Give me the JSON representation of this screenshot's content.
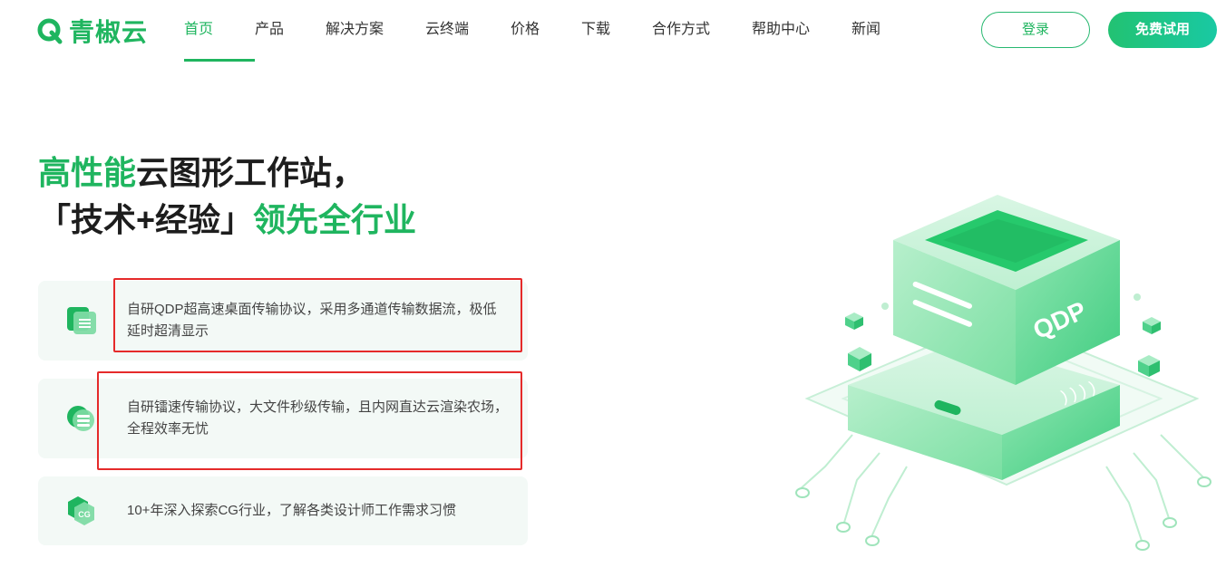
{
  "header": {
    "logo_text": "青椒云",
    "nav": [
      {
        "label": "首页",
        "active": true
      },
      {
        "label": "产品"
      },
      {
        "label": "解决方案"
      },
      {
        "label": "云终端"
      },
      {
        "label": "价格"
      },
      {
        "label": "下载"
      },
      {
        "label": "合作方式"
      },
      {
        "label": "帮助中心"
      },
      {
        "label": "新闻"
      }
    ],
    "login_label": "登录",
    "trial_label": "免费试用"
  },
  "hero": {
    "line1_green": "高性能",
    "line1_rest": "云图形工作站，",
    "line2_dark": "「技术+经验」",
    "line2_green": "领先全行业"
  },
  "features": [
    {
      "text": "自研QDP超高速桌面传输协议，采用多通道传输数据流，极低延时超清显示",
      "icon": "document-stack-icon"
    },
    {
      "text": "自研镭速传输协议，大文件秒级传输，且内网直达云渲染农场，全程效率无忧",
      "icon": "database-stack-icon"
    },
    {
      "text": "10+年深入探索CG行业，了解各类设计师工作需求习惯",
      "icon": "cg-hexagon-icon"
    }
  ],
  "illustration": {
    "label": "QDP"
  },
  "colors": {
    "brand": "#1fb55f",
    "brand_gradient_end": "#19c9a3",
    "annotation_red": "#e52a2a",
    "feature_bg": "#f3f9f6"
  }
}
